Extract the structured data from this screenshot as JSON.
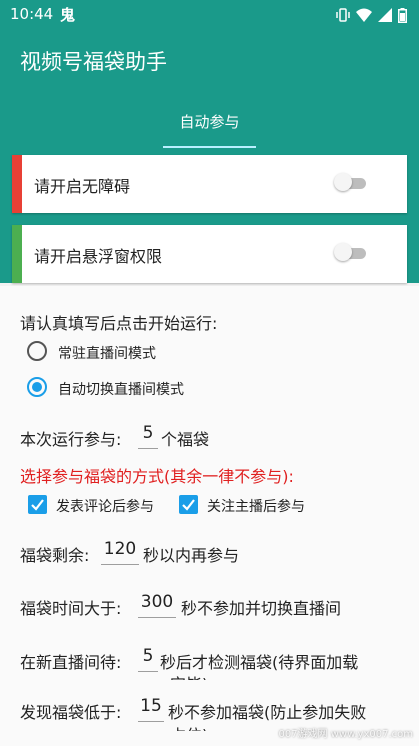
{
  "status_bar": {
    "time": "10:44",
    "notification_icon": "鬼"
  },
  "app_title": "视频号福袋助手",
  "tabs": [
    {
      "label": "自动参与",
      "active": true
    }
  ],
  "permissions": [
    {
      "label": "请开启无障碍",
      "accent": "#e84035",
      "enabled": false
    },
    {
      "label": "请开启悬浮窗权限",
      "accent": "#4caf50",
      "enabled": false
    }
  ],
  "run": {
    "prompt": "请认真填写后点击开始运行:",
    "modes": [
      {
        "label": "常驻直播间模式",
        "selected": false
      },
      {
        "label": "自动切换直播间模式",
        "selected": true
      }
    ]
  },
  "count": {
    "prefix": "本次运行参与:",
    "value": "5",
    "suffix": "个福袋"
  },
  "method": {
    "heading": "选择参与福袋的方式(其余一律不参与):",
    "options": [
      {
        "label": "发表评论后参与",
        "checked": true
      },
      {
        "label": "关注主播后参与",
        "checked": true
      }
    ]
  },
  "remaining": {
    "prefix": "福袋剩余:",
    "value": "120",
    "suffix": "秒以内再参与"
  },
  "duration": {
    "prefix": "福袋时间大于:",
    "value": "300",
    "suffix": "秒不参加并切换直播间"
  },
  "new_room": {
    "prefix": "在新直播间待:",
    "value": "5",
    "suffix": "秒后才检测福袋(待界面加载",
    "overflow": "完毕)"
  },
  "low": {
    "prefix": "发现福袋低于:",
    "value": "15",
    "suffix": "秒不参加福袋(防止参加失败",
    "overflow": "占位)"
  },
  "watermark": "007游戏网 www.yx007.com",
  "colors": {
    "header": "#1a9a8a",
    "accent_blue": "#1a9ee8",
    "warning_red": "#e02020"
  }
}
